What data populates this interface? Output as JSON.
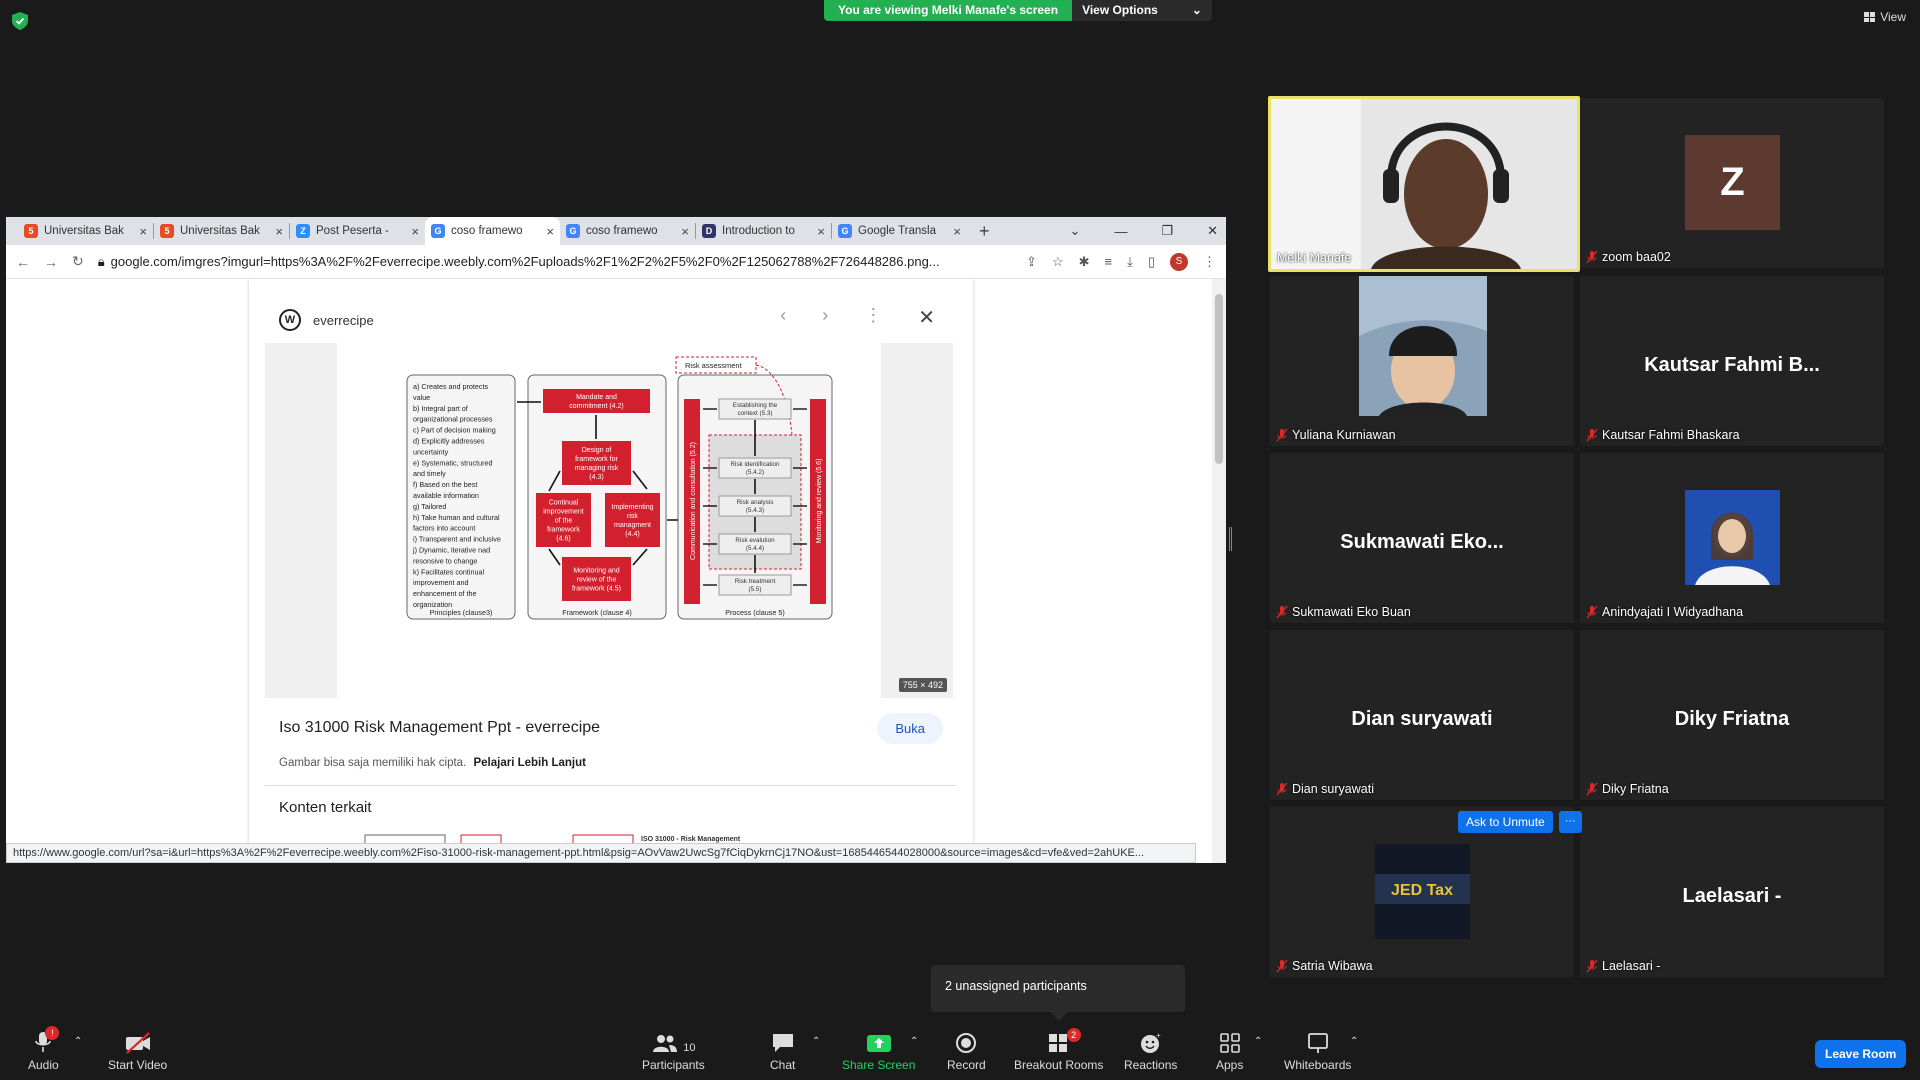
{
  "banner": {
    "message": "You are viewing Melki Manafe's screen",
    "options": "View Options"
  },
  "view_label": "View",
  "browser": {
    "tabs": [
      {
        "title": "Universitas Bak",
        "icon": "html5-icon",
        "active": false
      },
      {
        "title": "Universitas Bak",
        "icon": "html5-icon",
        "active": false
      },
      {
        "title": "Post Peserta -",
        "icon": "zoom-icon",
        "active": false
      },
      {
        "title": "coso framewo",
        "icon": "google-icon",
        "active": true
      },
      {
        "title": "coso framewo",
        "icon": "google-icon",
        "active": false
      },
      {
        "title": "Introduction to",
        "icon": "site-icon",
        "active": false
      },
      {
        "title": "Google Transla",
        "icon": "translate-icon",
        "active": false
      }
    ],
    "url": "google.com/imgres?imgurl=https%3A%2F%2Feverrecipe.weebly.com%2Fuploads%2F1%2F2%2F5%2F0%2F125062788%2F726448286.png...",
    "profile_initial": "S",
    "status_url": "https://www.google.com/url?sa=i&url=https%3A%2F%2Feverrecipe.weebly.com%2Fiso-31000-risk-management-ppt.html&psig=AOvVaw2UwcSg7fCiqDykrnCj17NO&ust=1685446544028000&source=images&cd=vfe&ved=2ahUKE..."
  },
  "image_panel": {
    "site": "everrecipe",
    "title": "Iso 31000 Risk Management Ppt - everrecipe",
    "open_button": "Buka",
    "caption": "Gambar bisa saja memiliki hak cipta.",
    "learn_more": "Pelajari Lebih Lanjut",
    "related_heading": "Konten terkait",
    "dimensions": "755 × 492",
    "related_thumb_text": "ISO 31000 - Risk Management",
    "diagram": {
      "principles_lines": [
        "a) Creates and protects",
        "value",
        "b) Integral part of",
        "organizational processes",
        "c) Part of decision making",
        "d) Explicitly addresses",
        "uncertainty",
        "e) Systematic, structured",
        "and timely",
        "f) Based on the best",
        "available information",
        "g) Tailored",
        "h) Take human and cultural",
        "factors into account",
        "i) Transparent and inclusive",
        "j) Dynamic, iterative nad",
        "resonsive to change",
        "k) Facilitates continual",
        "improvement and",
        "enhancement of the",
        "organization"
      ],
      "principles_label": "Principles (clause3)",
      "framework_label": "Framework (clause 4)",
      "process_label": "Process (clause 5)",
      "mandate": [
        "Mandate and",
        "commitment (4.2)"
      ],
      "design": [
        "Design of",
        "framework for",
        "managing risk",
        "(4.3)"
      ],
      "implementing": [
        "Implementing",
        "risk",
        "managment",
        "(4.4)"
      ],
      "continual": [
        "Continual",
        "improvement",
        "of the",
        "framework",
        "(4.6)"
      ],
      "monitoring_fw": [
        "Monitoring and",
        "review of the",
        "framework (4.5)"
      ],
      "risk_assessment": "Risk assessment",
      "establishing": [
        "Establishing the",
        "context (5.3)"
      ],
      "identification": [
        "Risk identification",
        "(5.4.2)"
      ],
      "analysis": [
        "Risk analysis",
        "(5.4.3)"
      ],
      "evaluation": [
        "Risk evalution",
        "(5.4.4)"
      ],
      "treatment": [
        "Risk treatment",
        "(5.5)"
      ],
      "communication": "Communication and consultation (5.2)",
      "monitoring_review": "Monitoring and review (5.6)"
    }
  },
  "participants": [
    {
      "name": "Melki Manafe",
      "display": "",
      "type": "video-speaker",
      "muted": false
    },
    {
      "name": "zoom baa02",
      "display": "Z",
      "type": "letter",
      "muted": true
    },
    {
      "name": "Yuliana Kurniawan",
      "display": "",
      "type": "video",
      "muted": true
    },
    {
      "name": "Kautsar Fahmi Bhaskara",
      "display": "Kautsar  Fahmi  B...",
      "type": "text",
      "muted": true
    },
    {
      "name": "Sukmawati Eko Buan",
      "display": "Sukmawati  Eko...",
      "type": "text",
      "muted": true
    },
    {
      "name": "Anindyajati I Widyadhana",
      "display": "",
      "type": "photo",
      "muted": true
    },
    {
      "name": "Dian suryawati",
      "display": "Dian suryawati",
      "type": "text",
      "muted": true
    },
    {
      "name": "Diky Friatna",
      "display": "Diky Friatna",
      "type": "text",
      "muted": true
    },
    {
      "name": "Satria Wibawa",
      "display": "",
      "type": "logo",
      "muted": true
    },
    {
      "name": "Laelasari -",
      "display": "Laelasari -",
      "type": "text",
      "muted": true
    }
  ],
  "ask_unmute": "Ask to Unmute",
  "more_options": "···",
  "logo_text": "JED Tax",
  "popup": "2 unassigned participants",
  "toolbar": {
    "audio": "Audio",
    "audio_badge": "!",
    "video": "Start Video",
    "participants": "Participants",
    "participants_count": "10",
    "chat": "Chat",
    "share": "Share Screen",
    "record": "Record",
    "breakout": "Breakout Rooms",
    "breakout_badge": "2",
    "reactions": "Reactions",
    "apps": "Apps",
    "whiteboards": "Whiteboards",
    "leave": "Leave Room"
  },
  "colors": {
    "banner_green": "#23b052",
    "zoom_blue": "#0e72ed",
    "speaker_border": "#e9e266",
    "diagram_red": "#d3202f",
    "muted_red": "#e02828"
  }
}
